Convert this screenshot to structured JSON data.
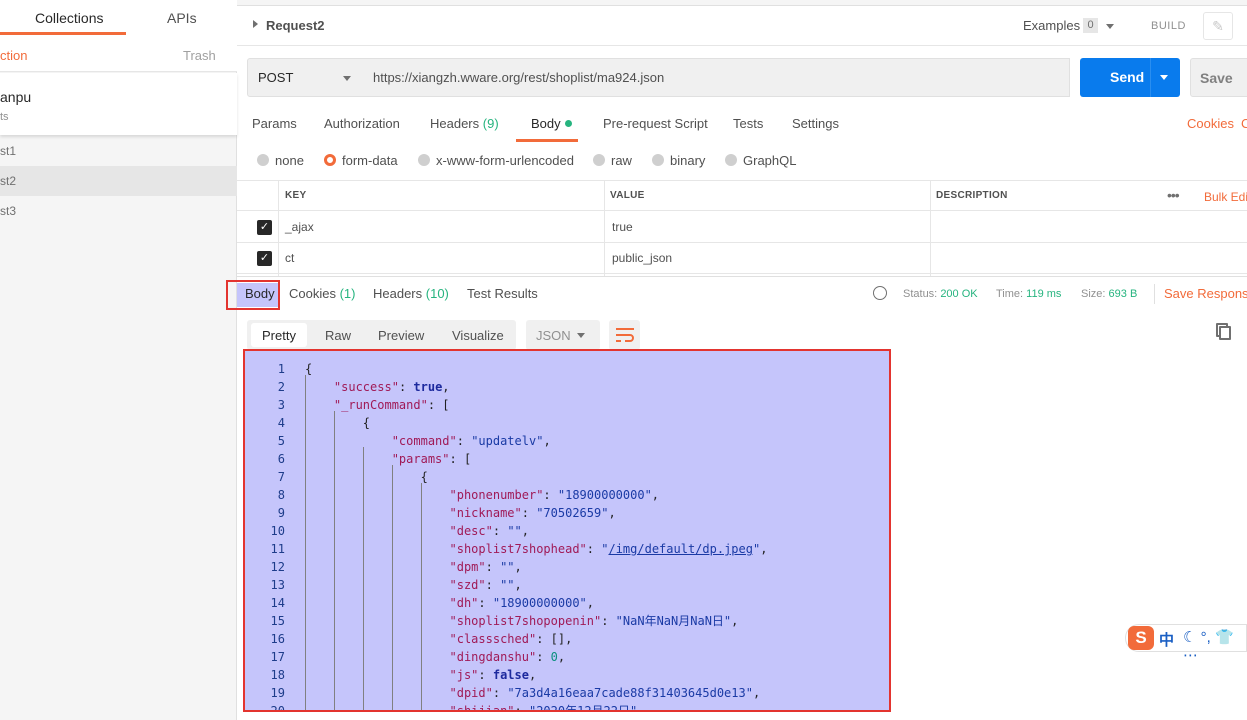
{
  "sidebar": {
    "tabs": [
      "Collections",
      "APIs"
    ],
    "sub_left": "ction",
    "sub_right": "Trash",
    "collection_name": "anpu",
    "collection_sub": "ts",
    "requests": [
      "st1",
      "st2",
      "st3"
    ]
  },
  "request": {
    "name": "Request2",
    "examples_label": "Examples",
    "examples_count": "0",
    "build_label": "BUILD",
    "method": "POST",
    "url": "https://xiangzh.wware.org/rest/shoplist/ma924.json",
    "send_label": "Send",
    "save_label": "Save",
    "tabs": {
      "params": "Params",
      "authorization": "Authorization",
      "headers": "Headers",
      "headers_count": "(9)",
      "body": "Body",
      "prerequest": "Pre-request Script",
      "tests": "Tests",
      "settings": "Settings",
      "cookies": "Cookies",
      "code": "C"
    },
    "body_types": [
      "none",
      "form-data",
      "x-www-form-urlencoded",
      "raw",
      "binary",
      "GraphQL"
    ],
    "table": {
      "headers": [
        "KEY",
        "VALUE",
        "DESCRIPTION"
      ],
      "bulk_edit": "Bulk Edi",
      "rows": [
        {
          "key": "_ajax",
          "value": "true"
        },
        {
          "key": "ct",
          "value": "public_json"
        }
      ]
    }
  },
  "response": {
    "tabs": {
      "body": "Body",
      "cookies": "Cookies",
      "cookies_count": "(1)",
      "headers": "Headers",
      "headers_count": "(10)",
      "tests": "Test Results"
    },
    "status_label": "Status:",
    "status_value": "200 OK",
    "time_label": "Time:",
    "time_value": "119 ms",
    "size_label": "Size:",
    "size_value": "693 B",
    "save_response": "Save Response",
    "view_tabs": [
      "Pretty",
      "Raw",
      "Preview",
      "Visualize"
    ],
    "format": "JSON"
  },
  "ime": {
    "logo": "S",
    "lang": "中"
  },
  "colors": {
    "accent": "#f26b3a",
    "send": "#097bed",
    "success": "#26b47f",
    "highlight": "#c5c5fb",
    "annotation": "#e3342f"
  }
}
